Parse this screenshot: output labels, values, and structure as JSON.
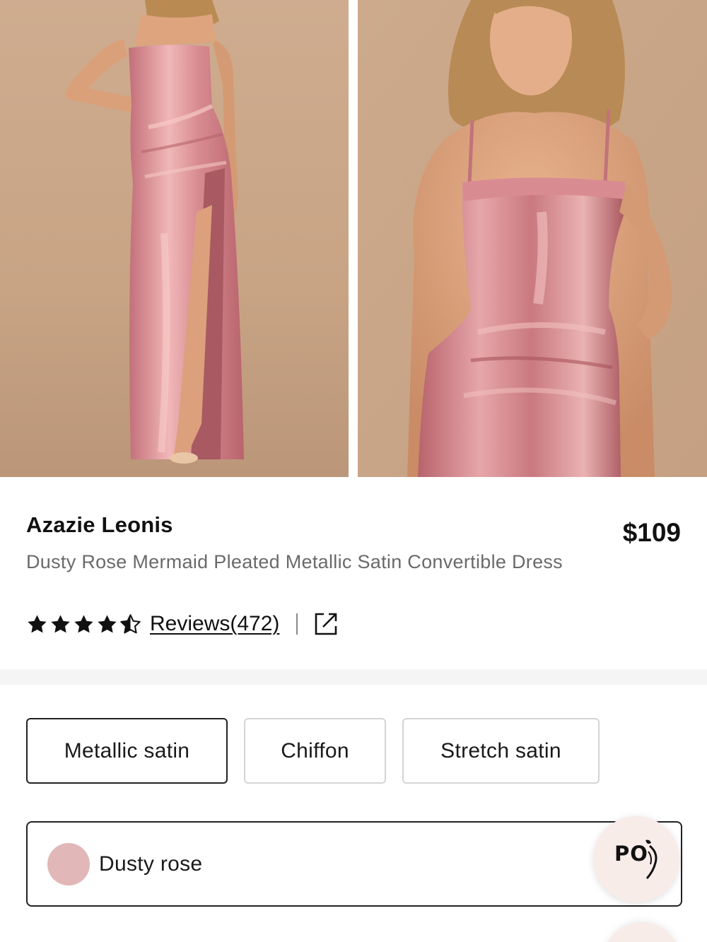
{
  "gallery": {
    "images": [
      {
        "alt": "Model wearing full-length strapless dusty rose satin dress with side slit"
      },
      {
        "alt": "Close-up of model wearing dusty rose satin dress with thin straps"
      }
    ]
  },
  "product": {
    "brand": "Azazie Leonis",
    "price": "$109",
    "title": "Dusty Rose Mermaid Pleated Metallic Satin Convertible Dress",
    "rating": 4.5,
    "reviews_label": "Reviews(472)"
  },
  "fabric_options": [
    {
      "label": "Metallic satin",
      "selected": true
    },
    {
      "label": "Chiffon",
      "selected": false
    },
    {
      "label": "Stretch satin",
      "selected": false
    }
  ],
  "color": {
    "name": "Dusty rose",
    "swatch_hex": "#e1b7b8"
  },
  "floating_badge": {
    "text": "PO",
    "icon": "sparkle-figure-icon"
  },
  "icons": {
    "star": "star-icon",
    "share": "external-link-icon"
  },
  "colors": {
    "text_primary": "#111111",
    "text_secondary": "#6a6a6a",
    "border_selected": "#222222",
    "border_unselected": "#d4d4d4",
    "background_photo": "#c9a88a",
    "dress": "#d98b91"
  }
}
